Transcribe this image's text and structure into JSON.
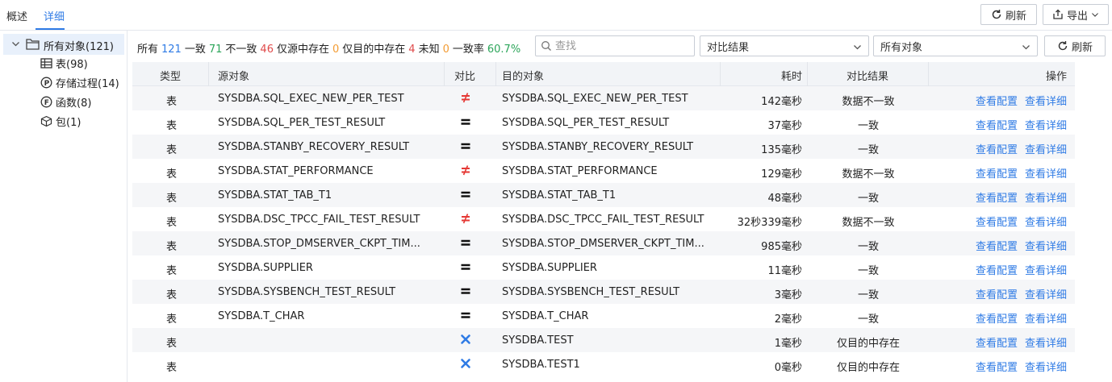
{
  "tabs": [
    "概述",
    "详细"
  ],
  "top_buttons": {
    "refresh": "刷新",
    "export": "导出"
  },
  "tree": {
    "root": "所有对象(121)",
    "items": [
      {
        "icon": "table-icon",
        "label": "表(98)"
      },
      {
        "icon": "procedure-icon",
        "label": "存储过程(14)"
      },
      {
        "icon": "function-icon",
        "label": "函数(8)"
      },
      {
        "icon": "package-icon",
        "label": "包(1)"
      }
    ]
  },
  "stats": {
    "all_label": "所有",
    "all": "121",
    "same_label": "一致",
    "same": "71",
    "diff_label": "不一致",
    "diff": "46",
    "src_only_label": "仅源中存在",
    "src_only": "0",
    "tgt_only_label": "仅目的中存在",
    "tgt_only": "4",
    "unknown_label": "未知",
    "unknown": "0",
    "rate_label": "一致率",
    "rate": "60.7%"
  },
  "search": {
    "placeholder": "查找"
  },
  "filters": {
    "result": "对比结果",
    "objects": "所有对象"
  },
  "refresh2": "刷新",
  "columns": {
    "type": "类型",
    "source": "源对象",
    "compare": "对比",
    "target": "目的对象",
    "time": "耗时",
    "result": "对比结果",
    "ops": "操作"
  },
  "rows": [
    {
      "type": "表",
      "source": "SYSDBA.SQL_EXEC_NEW_PER_TEST",
      "cmp": "neq",
      "target": "SYSDBA.SQL_EXEC_NEW_PER_TEST",
      "time": "142毫秒",
      "result": "数据不一致",
      "op1": "查看配置",
      "op2": "查看详细"
    },
    {
      "type": "表",
      "source": "SYSDBA.SQL_PER_TEST_RESULT",
      "cmp": "eq",
      "target": "SYSDBA.SQL_PER_TEST_RESULT",
      "time": "37毫秒",
      "result": "一致",
      "op1": "查看配置",
      "op2": "查看详细"
    },
    {
      "type": "表",
      "source": "SYSDBA.STANBY_RECOVERY_RESULT",
      "cmp": "eq",
      "target": "SYSDBA.STANBY_RECOVERY_RESULT",
      "time": "135毫秒",
      "result": "一致",
      "op1": "查看配置",
      "op2": "查看详细"
    },
    {
      "type": "表",
      "source": "SYSDBA.STAT_PERFORMANCE",
      "cmp": "neq",
      "target": "SYSDBA.STAT_PERFORMANCE",
      "time": "129毫秒",
      "result": "数据不一致",
      "op1": "查看配置",
      "op2": "查看详细"
    },
    {
      "type": "表",
      "source": "SYSDBA.STAT_TAB_T1",
      "cmp": "eq",
      "target": "SYSDBA.STAT_TAB_T1",
      "time": "48毫秒",
      "result": "一致",
      "op1": "查看配置",
      "op2": "查看详细"
    },
    {
      "type": "表",
      "source": "SYSDBA.DSC_TPCC_FAIL_TEST_RESULT",
      "cmp": "neq",
      "target": "SYSDBA.DSC_TPCC_FAIL_TEST_RESULT",
      "time": "32秒339毫秒",
      "result": "数据不一致",
      "op1": "查看配置",
      "op2": "查看详细"
    },
    {
      "type": "表",
      "source": "SYSDBA.STOP_DMSERVER_CKPT_TIM...",
      "cmp": "eq",
      "target": "SYSDBA.STOP_DMSERVER_CKPT_TIM...",
      "time": "985毫秒",
      "result": "一致",
      "op1": "查看配置",
      "op2": "查看详细"
    },
    {
      "type": "表",
      "source": "SYSDBA.SUPPLIER",
      "cmp": "eq",
      "target": "SYSDBA.SUPPLIER",
      "time": "11毫秒",
      "result": "一致",
      "op1": "查看配置",
      "op2": "查看详细"
    },
    {
      "type": "表",
      "source": "SYSDBA.SYSBENCH_TEST_RESULT",
      "cmp": "eq",
      "target": "SYSDBA.SYSBENCH_TEST_RESULT",
      "time": "3毫秒",
      "result": "一致",
      "op1": "查看配置",
      "op2": "查看详细"
    },
    {
      "type": "表",
      "source": "SYSDBA.T_CHAR",
      "cmp": "eq",
      "target": "SYSDBA.T_CHAR",
      "time": "2毫秒",
      "result": "一致",
      "op1": "查看配置",
      "op2": "查看详细"
    },
    {
      "type": "表",
      "source": "",
      "cmp": "missing",
      "target": "SYSDBA.TEST",
      "time": "1毫秒",
      "result": "仅目的中存在",
      "op1": "查看配置",
      "op2": "查看详细"
    },
    {
      "type": "表",
      "source": "",
      "cmp": "missing",
      "target": "SYSDBA.TEST1",
      "time": "0毫秒",
      "result": "仅目的中存在",
      "op1": "查看配置",
      "op2": "查看详细"
    }
  ]
}
